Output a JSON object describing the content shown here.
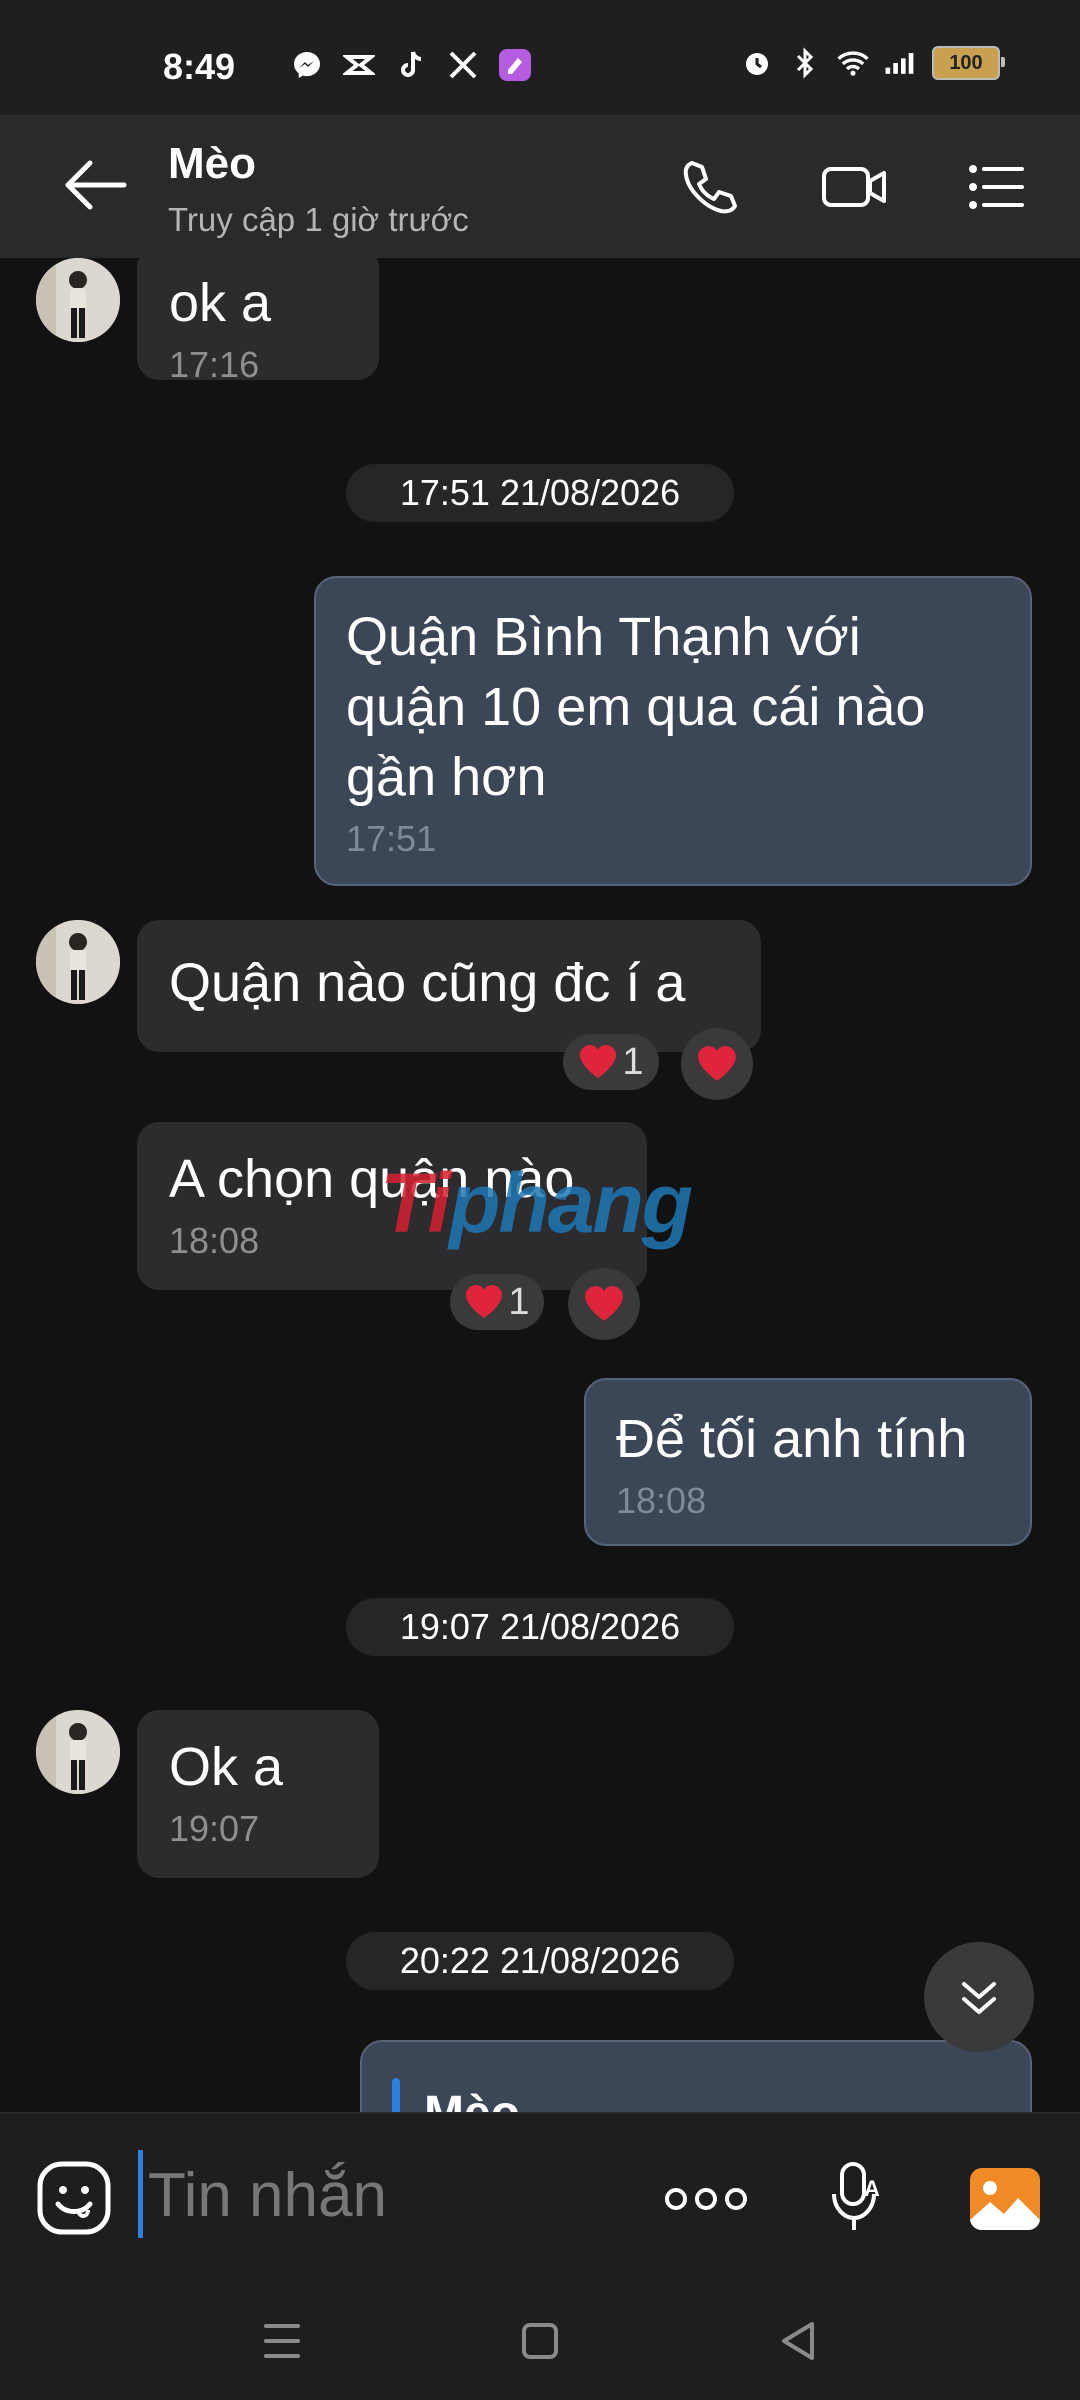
{
  "status_bar": {
    "time": "8:49",
    "battery": "100",
    "left_icons": [
      "messenger-icon",
      "capcut-icon",
      "tiktok-icon",
      "x-icon",
      "app-icon"
    ],
    "right_icons": [
      "alarm-icon",
      "bluetooth-icon",
      "wifi-icon",
      "signal-icon",
      "battery-icon"
    ]
  },
  "header": {
    "name": "Mèo",
    "last_seen": "Truy cập 1 giờ trước"
  },
  "messages": {
    "m1": {
      "text": "ok a",
      "time": "17:16"
    },
    "d1": "17:51 21/08/2026",
    "m2": {
      "text": "Quận Bình Thạnh với\nquận 10 em qua cái nào\ngần hơn",
      "time": "17:51"
    },
    "m3": {
      "text": "Quận nào cũng đc í a",
      "reaction_count": "1"
    },
    "m4": {
      "text": "A chọn quận nào",
      "time": "18:08",
      "reaction_count": "1"
    },
    "m5": {
      "text": "Để tối anh tính",
      "time": "18:08"
    },
    "d2": "19:07 21/08/2026",
    "m6": {
      "text": "Ok a",
      "time": "19:07"
    },
    "d3": "20:22 21/08/2026",
    "reply_preview_name": "Mèo"
  },
  "watermark": {
    "part1": "Ti",
    "part2": "phang"
  },
  "composer": {
    "placeholder": "Tin nhắn"
  },
  "colors": {
    "accent": "#2d7fe0",
    "heart": "#e0243a",
    "outgoing_bubble": "#3b4656",
    "incoming_bubble": "#2c2c2e",
    "gallery_orange": "#f08a24"
  }
}
